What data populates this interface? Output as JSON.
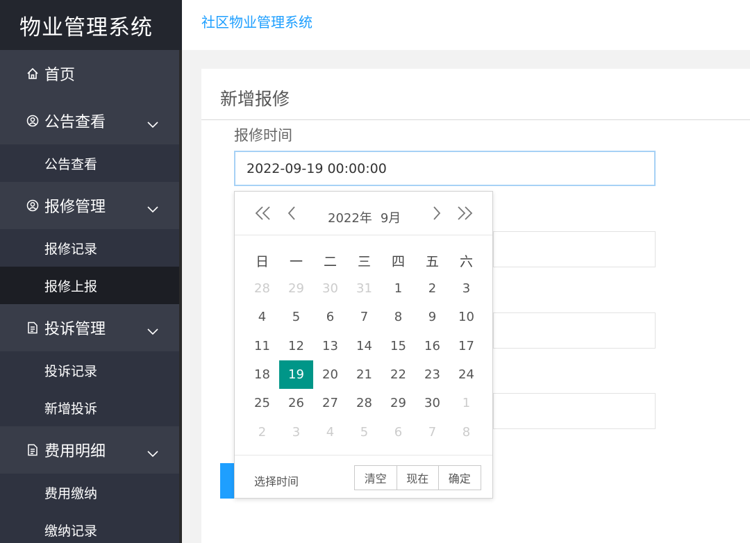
{
  "app": {
    "logo_text": "物业管理系统",
    "header_title": "社区物业管理系统"
  },
  "sidebar": {
    "home": "首页",
    "groups": [
      {
        "label": "公告查看",
        "icon": "user-circle-icon",
        "items": [
          "公告查看"
        ]
      },
      {
        "label": "报修管理",
        "icon": "user-circle-icon",
        "items": [
          "报修记录",
          "报修上报"
        ]
      },
      {
        "label": "投诉管理",
        "icon": "document-icon",
        "items": [
          "投诉记录",
          "新增投诉"
        ]
      },
      {
        "label": "费用明细",
        "icon": "document-icon",
        "items": [
          "费用缴纳",
          "缴纳记录"
        ]
      }
    ],
    "active_item": "报修上报"
  },
  "form": {
    "title": "新增报修",
    "time_label": "报修时间",
    "time_value": "2022-09-19 00:00:00"
  },
  "datepicker": {
    "year_label": "2022年",
    "month_label": "9月",
    "weekdays": [
      "日",
      "一",
      "二",
      "三",
      "四",
      "五",
      "六"
    ],
    "days": [
      {
        "d": "28",
        "other": true
      },
      {
        "d": "29",
        "other": true
      },
      {
        "d": "30",
        "other": true
      },
      {
        "d": "31",
        "other": true
      },
      {
        "d": "1"
      },
      {
        "d": "2"
      },
      {
        "d": "3"
      },
      {
        "d": "4"
      },
      {
        "d": "5"
      },
      {
        "d": "6"
      },
      {
        "d": "7"
      },
      {
        "d": "8"
      },
      {
        "d": "9"
      },
      {
        "d": "10"
      },
      {
        "d": "11"
      },
      {
        "d": "12"
      },
      {
        "d": "13"
      },
      {
        "d": "14"
      },
      {
        "d": "15"
      },
      {
        "d": "16"
      },
      {
        "d": "17"
      },
      {
        "d": "18"
      },
      {
        "d": "19",
        "selected": true
      },
      {
        "d": "20"
      },
      {
        "d": "21"
      },
      {
        "d": "22"
      },
      {
        "d": "23"
      },
      {
        "d": "24"
      },
      {
        "d": "25"
      },
      {
        "d": "26"
      },
      {
        "d": "27"
      },
      {
        "d": "28"
      },
      {
        "d": "29"
      },
      {
        "d": "30"
      },
      {
        "d": "1",
        "other": true
      },
      {
        "d": "2",
        "other": true
      },
      {
        "d": "3",
        "other": true
      },
      {
        "d": "4",
        "other": true
      },
      {
        "d": "5",
        "other": true
      },
      {
        "d": "6",
        "other": true
      },
      {
        "d": "7",
        "other": true
      },
      {
        "d": "8",
        "other": true
      }
    ],
    "select_time_label": "选择时间",
    "clear_label": "清空",
    "now_label": "现在",
    "confirm_label": "确定"
  },
  "colors": {
    "accent": "#1e9fff",
    "selected_day": "#009688",
    "sidebar_bg": "#393d49"
  }
}
